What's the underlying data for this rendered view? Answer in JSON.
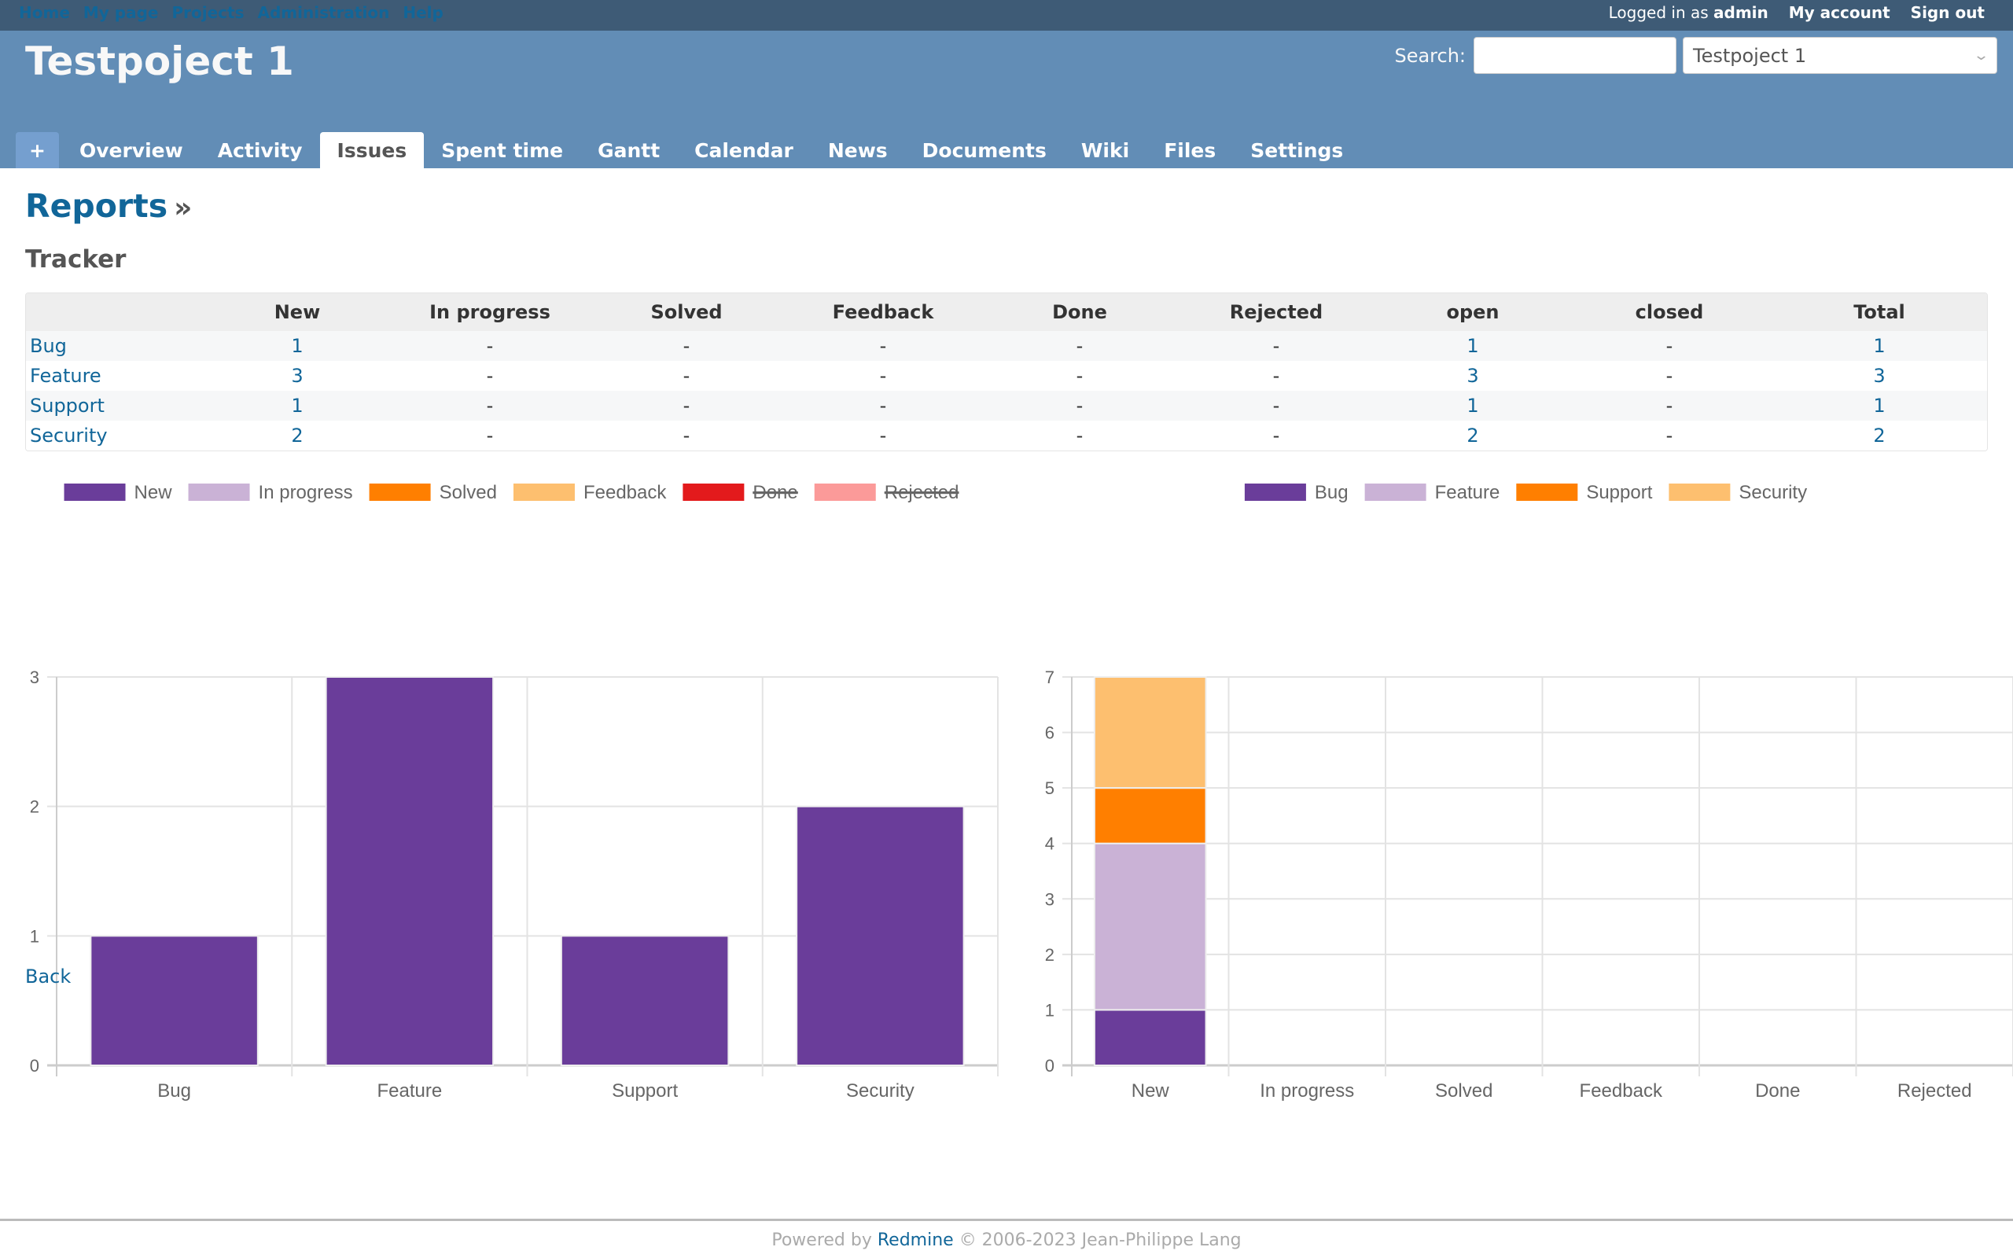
{
  "top_menu": {
    "left": [
      "Home",
      "My page",
      "Projects",
      "Administration",
      "Help"
    ],
    "logged_in_prefix": "Logged in as",
    "user": "admin",
    "my_account": "My account",
    "sign_out": "Sign out"
  },
  "header": {
    "project_title": "Testpoject 1",
    "search_label": "Search:",
    "search_value": "",
    "project_jump": "Testpoject 1"
  },
  "main_menu": {
    "plus": "+",
    "tabs": [
      "Overview",
      "Activity",
      "Issues",
      "Spent time",
      "Gantt",
      "Calendar",
      "News",
      "Documents",
      "Wiki",
      "Files",
      "Settings"
    ],
    "selected": "Issues"
  },
  "page": {
    "heading": "Reports",
    "heading_sep": "»",
    "section": "Tracker",
    "back": "Back"
  },
  "table": {
    "columns": [
      "",
      "New",
      "In progress",
      "Solved",
      "Feedback",
      "Done",
      "Rejected",
      "open",
      "closed",
      "Total"
    ],
    "rows": [
      [
        "Bug",
        "1",
        "-",
        "-",
        "-",
        "-",
        "-",
        "1",
        "-",
        "1"
      ],
      [
        "Feature",
        "3",
        "-",
        "-",
        "-",
        "-",
        "-",
        "3",
        "-",
        "3"
      ],
      [
        "Support",
        "1",
        "-",
        "-",
        "-",
        "-",
        "-",
        "1",
        "-",
        "1"
      ],
      [
        "Security",
        "2",
        "-",
        "-",
        "-",
        "-",
        "-",
        "2",
        "-",
        "2"
      ]
    ]
  },
  "colors": {
    "purple": "#6a3d9a",
    "lavender": "#cab2d6",
    "orange": "#ff7f00",
    "light_orange": "#fdbf6f",
    "red": "#e31a1c",
    "pink": "#fb9a99"
  },
  "chart_data": [
    {
      "type": "bar",
      "stacked": true,
      "categories": [
        "Bug",
        "Feature",
        "Support",
        "Security"
      ],
      "series": [
        {
          "name": "New",
          "color": "#6a3d9a",
          "hidden": false,
          "values": [
            1,
            3,
            1,
            2
          ]
        },
        {
          "name": "In progress",
          "color": "#cab2d6",
          "hidden": false,
          "values": [
            0,
            0,
            0,
            0
          ]
        },
        {
          "name": "Solved",
          "color": "#ff7f00",
          "hidden": false,
          "values": [
            0,
            0,
            0,
            0
          ]
        },
        {
          "name": "Feedback",
          "color": "#fdbf6f",
          "hidden": false,
          "values": [
            0,
            0,
            0,
            0
          ]
        },
        {
          "name": "Done",
          "color": "#e31a1c",
          "hidden": true,
          "values": [
            0,
            0,
            0,
            0
          ]
        },
        {
          "name": "Rejected",
          "color": "#fb9a99",
          "hidden": true,
          "values": [
            0,
            0,
            0,
            0
          ]
        }
      ],
      "ylim": [
        0,
        3
      ],
      "yticks": [
        0,
        1,
        2,
        3
      ],
      "legend": "top",
      "grid": true
    },
    {
      "type": "bar",
      "stacked": true,
      "categories": [
        "New",
        "In progress",
        "Solved",
        "Feedback",
        "Done",
        "Rejected"
      ],
      "series": [
        {
          "name": "Bug",
          "color": "#6a3d9a",
          "hidden": false,
          "values": [
            1,
            0,
            0,
            0,
            0,
            0
          ]
        },
        {
          "name": "Feature",
          "color": "#cab2d6",
          "hidden": false,
          "values": [
            3,
            0,
            0,
            0,
            0,
            0
          ]
        },
        {
          "name": "Support",
          "color": "#ff7f00",
          "hidden": false,
          "values": [
            1,
            0,
            0,
            0,
            0,
            0
          ]
        },
        {
          "name": "Security",
          "color": "#fdbf6f",
          "hidden": false,
          "values": [
            2,
            0,
            0,
            0,
            0,
            0
          ]
        }
      ],
      "ylim": [
        0,
        7
      ],
      "yticks": [
        0,
        1,
        2,
        3,
        4,
        5,
        6,
        7
      ],
      "legend": "top",
      "grid": true
    }
  ],
  "footer": {
    "prefix": "Powered by",
    "link": "Redmine",
    "suffix": "© 2006-2023 Jean-Philippe Lang"
  }
}
